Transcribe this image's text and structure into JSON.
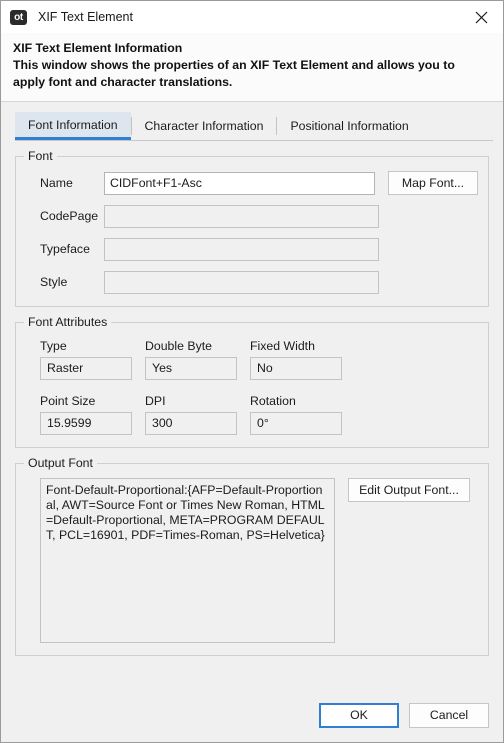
{
  "window": {
    "logo_text": "ot",
    "title": "XIF Text Element",
    "close_icon": "close-icon"
  },
  "header": {
    "title": "XIF Text Element Information",
    "description": "This window shows the properties of an XIF Text Element and allows you to apply font and character translations."
  },
  "tabs": [
    {
      "label": "Font Information",
      "active": true
    },
    {
      "label": "Character Information",
      "active": false
    },
    {
      "label": "Positional Information",
      "active": false
    }
  ],
  "font_group": {
    "legend": "Font",
    "fields": [
      {
        "label": "Name",
        "value": "CIDFont+F1-Asc"
      },
      {
        "label": "CodePage",
        "value": ""
      },
      {
        "label": "Typeface",
        "value": ""
      },
      {
        "label": "Style",
        "value": ""
      }
    ],
    "map_font_button": "Map Font..."
  },
  "font_attributes": {
    "legend": "Font Attributes",
    "items": [
      {
        "label": "Type",
        "value": "Raster"
      },
      {
        "label": "Double Byte",
        "value": "Yes"
      },
      {
        "label": "Fixed Width",
        "value": "No"
      },
      {
        "label": "Point Size",
        "value": "15.9599"
      },
      {
        "label": "DPI",
        "value": "300"
      },
      {
        "label": "Rotation",
        "value": "0°"
      }
    ]
  },
  "output_font": {
    "legend": "Output Font",
    "value": "Font-Default-Proportional:{AFP=Default-Proportional, AWT=Source Font or Times New Roman, HTML=Default-Proportional, META=PROGRAM DEFAULT, PCL=16901, PDF=Times-Roman, PS=Helvetica}",
    "edit_button": "Edit Output Font..."
  },
  "footer": {
    "ok_label": "OK",
    "cancel_label": "Cancel"
  },
  "colors": {
    "accent": "#2f80d1",
    "active_tab_bg": "#dde6ef",
    "window_bg": "#f0f0f0",
    "titlebar_bg": "#ffffff"
  }
}
